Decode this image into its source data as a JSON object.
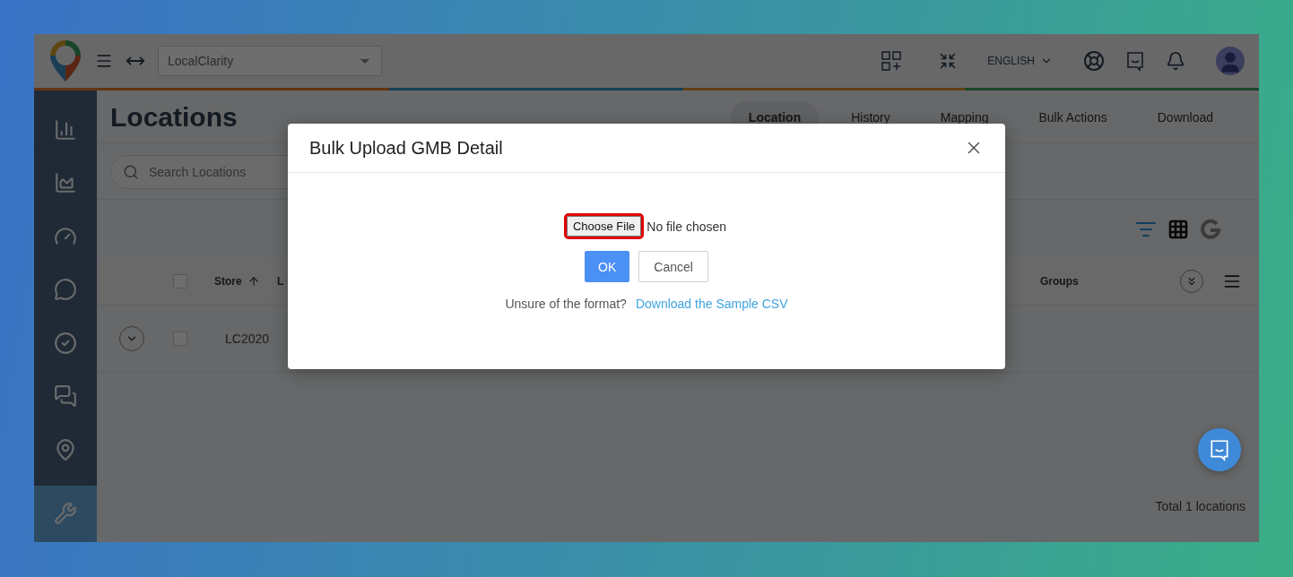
{
  "header": {
    "workspace_select": {
      "value": "LocalClarity"
    },
    "language": "ENGLISH"
  },
  "sidebar": {
    "items": [
      {
        "kind": "column-chart",
        "selected": false
      },
      {
        "kind": "area-chart",
        "selected": false
      },
      {
        "kind": "gauge",
        "selected": false
      },
      {
        "kind": "comment",
        "selected": false
      },
      {
        "kind": "check",
        "selected": false
      },
      {
        "kind": "qa",
        "selected": false
      },
      {
        "kind": "pin",
        "selected": false
      },
      {
        "kind": "wrench",
        "selected": true
      }
    ]
  },
  "page": {
    "title": "Locations",
    "tabs": [
      {
        "label": "Location",
        "selected": true
      },
      {
        "label": "History",
        "selected": false
      },
      {
        "label": "Mapping",
        "selected": false
      },
      {
        "label": "Bulk Actions",
        "selected": false
      },
      {
        "label": "Download",
        "selected": false
      }
    ],
    "search": {
      "placeholder": "Search Locations"
    },
    "view_modes": [
      {
        "kind": "list",
        "selected": true
      },
      {
        "kind": "grid",
        "selected": false
      },
      {
        "kind": "google",
        "selected": false
      }
    ],
    "table": {
      "columns": [
        {
          "label": "Store",
          "sorted": true
        },
        {
          "label": "L"
        },
        {
          "label": "Groups"
        }
      ],
      "rows": [
        {
          "store": "LC2020",
          "checked": false,
          "expanded": false
        }
      ],
      "all_checked": false
    },
    "footer": "Total 1 locations"
  },
  "dialog": {
    "title": "Bulk Upload GMB Detail",
    "file_input": {
      "button_label": "Choose File",
      "status": "No file chosen",
      "highlighted": true
    },
    "buttons": [
      {
        "label": "OK",
        "kind": "primary"
      },
      {
        "label": "Cancel",
        "kind": "secondary"
      }
    ],
    "hint": "Unsure of the format?",
    "link": "Download the Sample CSV"
  }
}
